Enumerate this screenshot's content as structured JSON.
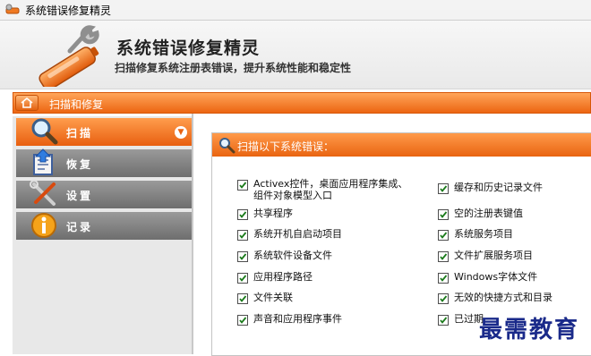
{
  "window": {
    "title": "系统错误修复精灵",
    "app_icon": "app-icon"
  },
  "banner": {
    "title": "系统错误修复精灵",
    "subtitle": "扫描修复系统注册表错误，提升系统性能和稳定性",
    "logo_icon": "wrench-battery-icon"
  },
  "navbar": {
    "label": "扫描和修复",
    "home_icon": "home-icon"
  },
  "sidebar": {
    "items": [
      {
        "label": "扫描",
        "icon": "magnifier-icon",
        "active": true
      },
      {
        "label": "恢复",
        "icon": "restore-icon",
        "active": false
      },
      {
        "label": "设置",
        "icon": "tools-icon",
        "active": false
      },
      {
        "label": "记录",
        "icon": "info-icon",
        "active": false
      }
    ]
  },
  "panel": {
    "title": "扫描以下系统错误：",
    "icon": "scan-icon",
    "left_items": [
      {
        "label": "Activex控件，桌面应用程序集成、组件对象模型入口",
        "checked": true
      },
      {
        "label": "共享程序",
        "checked": true
      },
      {
        "label": "系统开机自启动项目",
        "checked": true
      },
      {
        "label": "系统软件设备文件",
        "checked": true
      },
      {
        "label": "应用程序路径",
        "checked": true
      },
      {
        "label": "文件关联",
        "checked": true
      },
      {
        "label": "声音和应用程序事件",
        "checked": true
      }
    ],
    "right_items": [
      {
        "label": "缓存和历史记录文件",
        "checked": true
      },
      {
        "label": "空的注册表键值",
        "checked": true
      },
      {
        "label": "系统服务项目",
        "checked": true
      },
      {
        "label": "文件扩展服务项目",
        "checked": true
      },
      {
        "label": "Windows字体文件",
        "checked": true
      },
      {
        "label": "无效的快捷方式和目录",
        "checked": true
      },
      {
        "label": "已过期",
        "checked": true
      }
    ]
  },
  "watermark": {
    "text": "最需教育"
  },
  "colors": {
    "accent": "#ec6511",
    "sidebar_inactive": "#7e7e7e"
  }
}
